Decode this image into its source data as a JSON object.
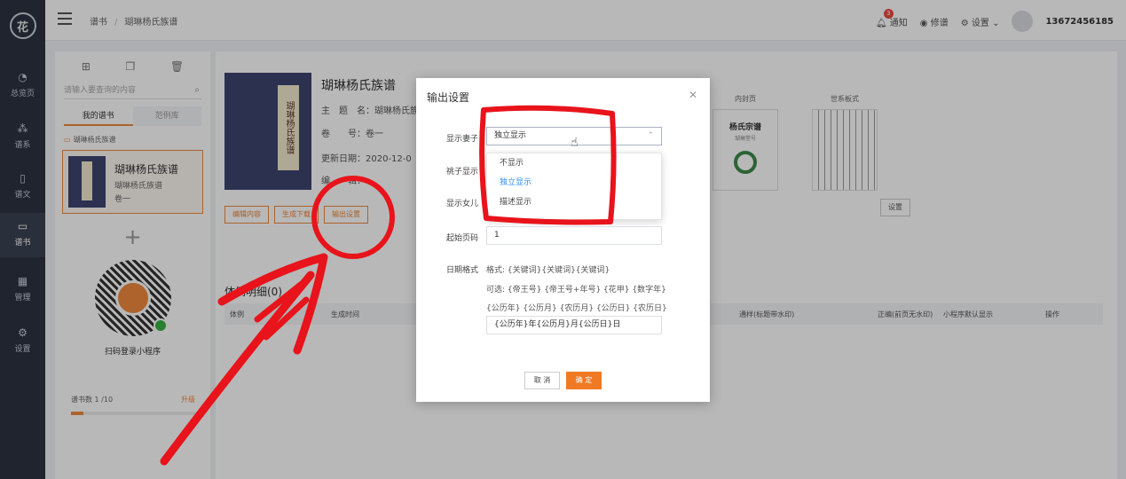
{
  "nav": {
    "logo": "花",
    "items": [
      {
        "label": "总览页",
        "icon": "pie-chart-icon"
      },
      {
        "label": "谱系",
        "icon": "tree-icon"
      },
      {
        "label": "谱文",
        "icon": "document-icon"
      },
      {
        "label": "谱书",
        "icon": "book-icon"
      },
      {
        "label": "管理",
        "icon": "grid-icon"
      },
      {
        "label": "设置",
        "icon": "gear-icon"
      }
    ]
  },
  "header": {
    "breadcrumb": [
      "谱书",
      "瑚琳杨氏族谱"
    ],
    "notify_label": "通知",
    "notify_count": "3",
    "view_label": "修谱",
    "settings_label": "设置",
    "phone": "13672456185"
  },
  "left": {
    "search_placeholder": "请输入要查询的内容",
    "tabs": [
      "我的谱书",
      "范例库"
    ],
    "folder": "瑚琳杨氏族谱",
    "card": {
      "title": "瑚琳杨氏族谱",
      "subtitle": "瑚琳杨氏族谱",
      "volume": "卷一"
    },
    "qr_label": "扫码登录小程序",
    "quota_label": "谱书数 1 /10",
    "upgrade_label": "升级",
    "quota_fraction": 0.1
  },
  "main": {
    "title": "瑚琳杨氏族谱",
    "cover_label": "瑚琳杨氏族谱",
    "meta_subject": "主　题　名：瑚琳杨氏族",
    "meta_volume": "卷　　号：卷一",
    "meta_date": "更新日期：2020-12-0",
    "meta_edit": "编　　辑：",
    "buttons": [
      "编辑内容",
      "生成下载",
      "输出设置"
    ],
    "thumb_captions": [
      "内封页",
      "世系板式"
    ],
    "thumb_title": "杨氏宗谱",
    "thumb_sub": "瑚琳堂号",
    "set_button": "设置",
    "section_title": "体例明细(0)",
    "table_headers": [
      "体例",
      "生成时间",
      "通样(标题带水印)",
      "正编(前页无水印)",
      "小程序默认显示",
      "操作"
    ]
  },
  "modal": {
    "title": "输出设置",
    "labels": {
      "spouse": "显示妻子",
      "adopted": "祧子显示",
      "daughter": "显示女儿",
      "start_page": "起始页码",
      "date_format": "日期格式"
    },
    "select_value": "独立显示",
    "options": [
      "不显示",
      "独立显示",
      "描述显示"
    ],
    "start_page": "1",
    "format_line": "格式: {关键词}{关键词}{关键词}",
    "optional_line1": "可选: {帝王号} {帝王号+年号} {花甲} {数字年}",
    "optional_line2": "{公历年} {公历月} {农历月} {公历日} {农历日}",
    "date_format_value": "{公历年}年{公历月}月{公历日}日",
    "cancel": "取 消",
    "ok": "确 定"
  },
  "colors": {
    "accent": "#f08a3c",
    "annotation": "#e8131b",
    "nav_bg": "#2b3240"
  }
}
